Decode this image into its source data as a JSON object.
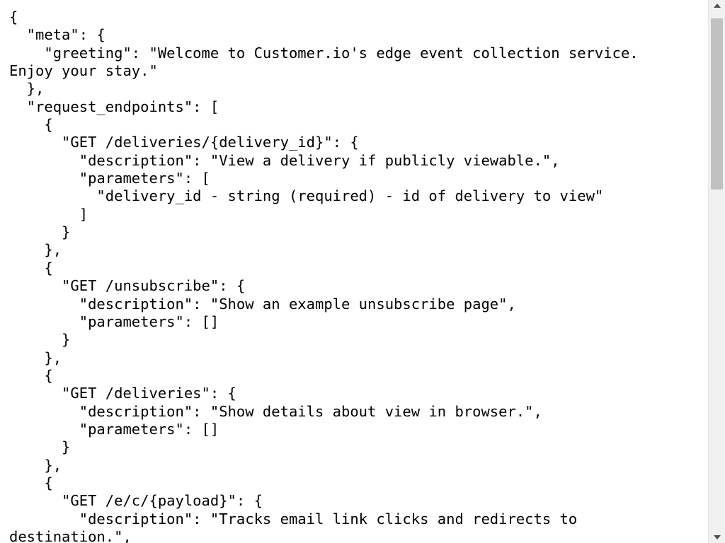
{
  "document": {
    "lines": [
      "{",
      "  \"meta\": {",
      "    \"greeting\": \"Welcome to Customer.io's edge event collection service.",
      "Enjoy your stay.\"",
      "  },",
      "  \"request_endpoints\": [",
      "    {",
      "      \"GET /deliveries/{delivery_id}\": {",
      "        \"description\": \"View a delivery if publicly viewable.\",",
      "        \"parameters\": [",
      "          \"delivery_id - string (required) - id of delivery to view\"",
      "        ]",
      "      }",
      "    },",
      "    {",
      "      \"GET /unsubscribe\": {",
      "        \"description\": \"Show an example unsubscribe page\",",
      "        \"parameters\": []",
      "      }",
      "    },",
      "    {",
      "      \"GET /deliveries\": {",
      "        \"description\": \"Show details about view in browser.\",",
      "        \"parameters\": []",
      "      }",
      "    },",
      "    {",
      "      \"GET /e/c/{payload}\": {",
      "        \"description\": \"Tracks email link clicks and redirects to",
      "destination.\","
    ]
  },
  "scrollbar": {
    "up_icon": "scroll-up-arrow-icon",
    "down_icon": "scroll-down-arrow-icon"
  },
  "colors": {
    "text": "#000000",
    "background": "#ffffff",
    "scroll_track": "#f1f1f1",
    "scroll_thumb": "#c1c1c1"
  }
}
